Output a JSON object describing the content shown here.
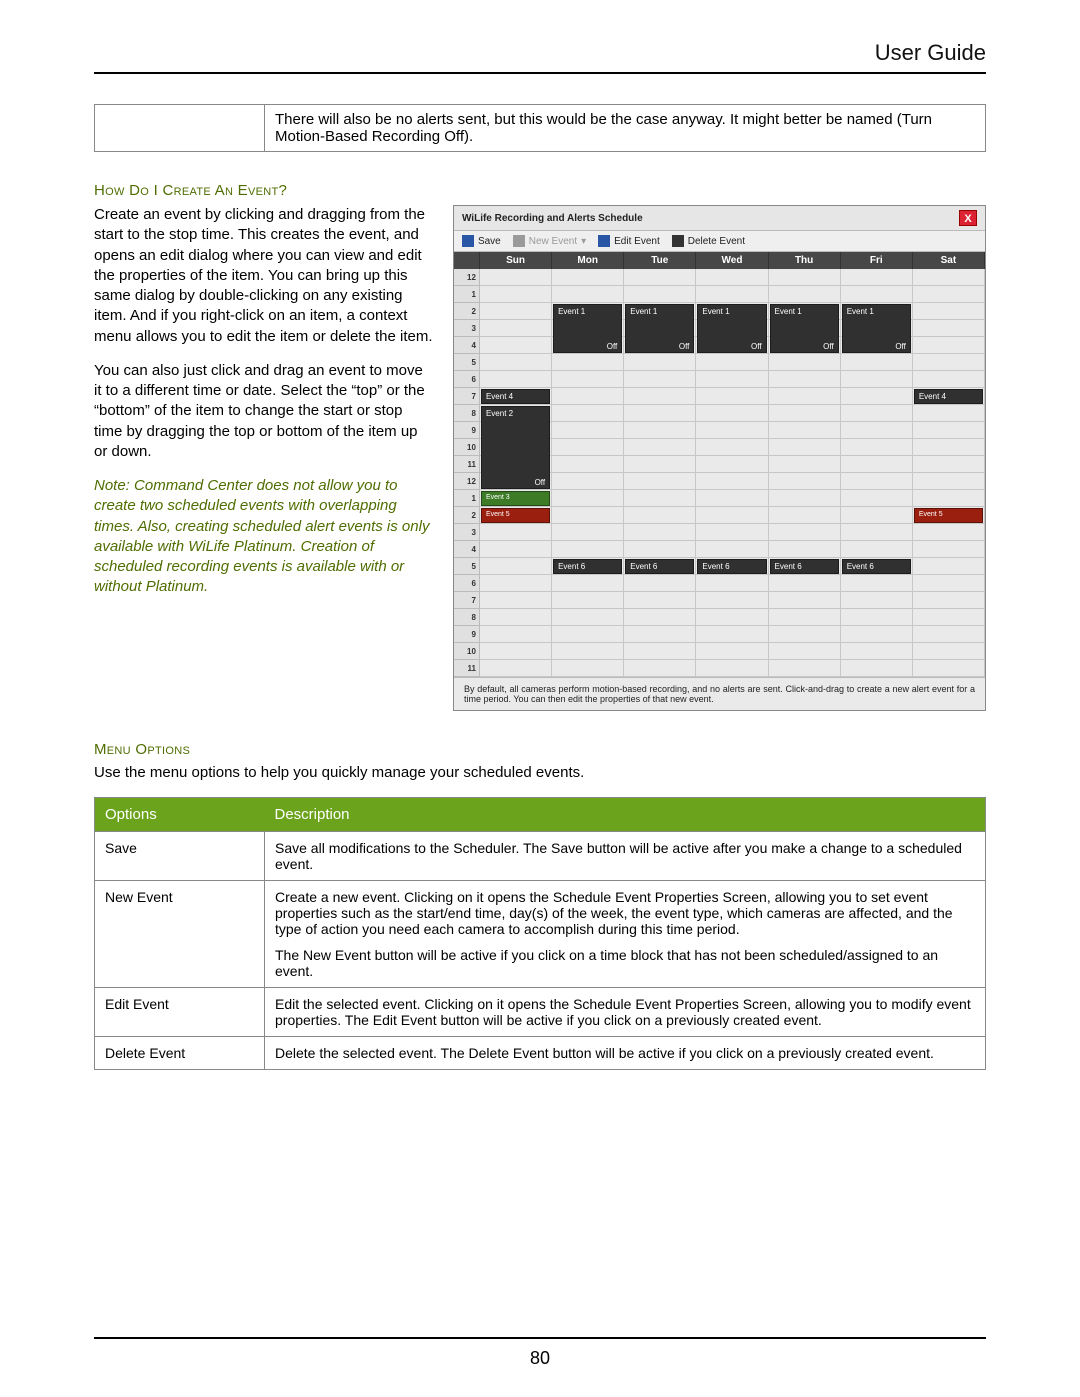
{
  "header_title": "User Guide",
  "page_number": "80",
  "top_note": "There will also be no alerts sent, but this would be the case anyway.  It might better be named (Turn Motion-Based Recording Off).",
  "section1_title": "How Do I Create An Event?",
  "section1_p1": "Create an event by clicking and dragging from the start to the stop time.  This creates the event, and opens an edit dialog where you can view and edit the properties of the item.  You can bring up this same dialog by double-clicking on any existing item.  And if you right-click on an item, a context menu allows you to edit the item or delete the item.",
  "section1_p2": "You can also just click and drag an event to move it to a different time or date.  Select the “top” or the “bottom” of the item to change the start or stop time by dragging the top or bottom of the item up or down.",
  "section1_note": "Note: Command Center does not allow you to create two scheduled events with overlapping times.  Also, creating scheduled alert events is only available with WiLife Platinum.  Creation of scheduled recording events is available with or without Platinum.",
  "section2_title": "Menu Options",
  "section2_intro": "Use the menu options to help you quickly manage your scheduled events.",
  "opts_head_a": "Options",
  "opts_head_b": "Description",
  "opts_rows": {
    "save": {
      "name": "Save",
      "desc_a": "Save all modifications to the Scheduler. The Save button will be active after you make a change to a scheduled event."
    },
    "new": {
      "name": "New Event",
      "desc_a": "Create a new event. Clicking on it opens the Schedule Event Properties Screen, allowing you to set event properties such as the start/end time, day(s) of the week, the event type, which cameras are affected, and the type of action you need each camera to accomplish during this time period.",
      "desc_b": "The New Event button will be active if you click on a time block that has not been scheduled/assigned to an event."
    },
    "edit": {
      "name": "Edit Event",
      "desc_a": "Edit the selected event. Clicking on it opens the Schedule Event Properties Screen, allowing you to modify event properties.  The Edit Event button will be active if you click on a previously created event."
    },
    "del": {
      "name": "Delete Event",
      "desc_a": "Delete the selected event. The Delete Event button will be active if you click on a previously created event."
    }
  },
  "shot": {
    "title": "WiLife Recording and Alerts Schedule",
    "toolbar": {
      "save": "Save",
      "new": "New Event",
      "edit": "Edit Event",
      "del": "Delete Event"
    },
    "days": [
      "Sun",
      "Mon",
      "Tue",
      "Wed",
      "Thu",
      "Fri",
      "Sat"
    ],
    "hours": [
      "12",
      "1",
      "2",
      "3",
      "4",
      "5",
      "6",
      "7",
      "8",
      "9",
      "10",
      "11",
      "12",
      "1",
      "2",
      "3",
      "4",
      "5",
      "6",
      "7",
      "8",
      "9",
      "10",
      "11"
    ],
    "off_label": "Off",
    "event1": "Event 1",
    "event2": "Event 2",
    "event3": "Event 3",
    "event4": "Event 4",
    "event5": "Event 5",
    "event6": "Event 6",
    "footer": "By default, all cameras perform motion-based recording, and no alerts are sent. Click-and-drag to create a new alert event for a time period. You can then edit the properties of that new event."
  }
}
